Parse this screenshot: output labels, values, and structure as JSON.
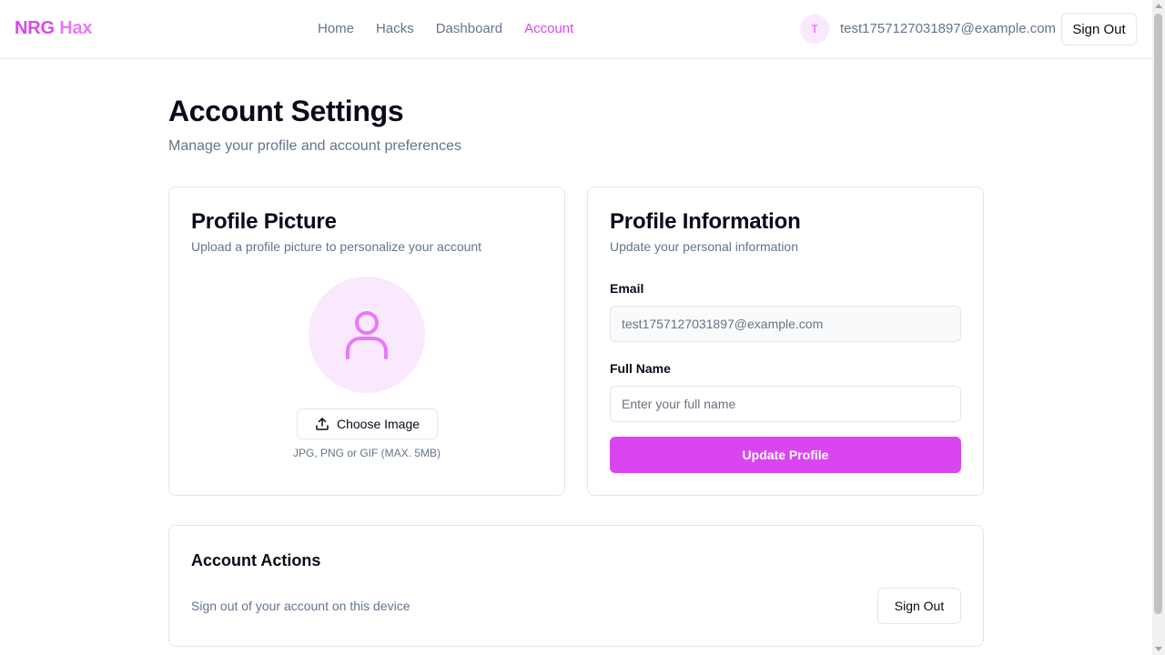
{
  "header": {
    "brand_main": "NRG",
    "brand_accent": "Hax",
    "nav": [
      {
        "label": "Home"
      },
      {
        "label": "Hacks"
      },
      {
        "label": "Dashboard"
      },
      {
        "label": "Account",
        "active": true
      }
    ],
    "avatar_initial": "T",
    "user_email": "test1757127031897@example.com",
    "signout_label": "Sign Out"
  },
  "page": {
    "title": "Account Settings",
    "subtitle": "Manage your profile and account preferences"
  },
  "profile_picture": {
    "title": "Profile Picture",
    "description": "Upload a profile picture to personalize your account",
    "placeholder_icon": "user-icon",
    "choose_label": "Choose Image",
    "upload_icon": "upload-icon",
    "hint": "JPG, PNG or GIF (MAX. 5MB)"
  },
  "profile_info": {
    "title": "Profile Information",
    "description": "Update your personal information",
    "email_label": "Email",
    "email_value": "test1757127031897@example.com",
    "fullname_label": "Full Name",
    "fullname_placeholder": "Enter your full name",
    "fullname_value": "",
    "submit_label": "Update Profile"
  },
  "account_actions": {
    "title": "Account Actions",
    "description": "Sign out of your account on this device",
    "signout_label": "Sign Out"
  },
  "colors": {
    "accent": "#d946ef",
    "accent_light": "#fae8ff",
    "muted_text": "#64748b",
    "border": "#e5e7eb"
  }
}
